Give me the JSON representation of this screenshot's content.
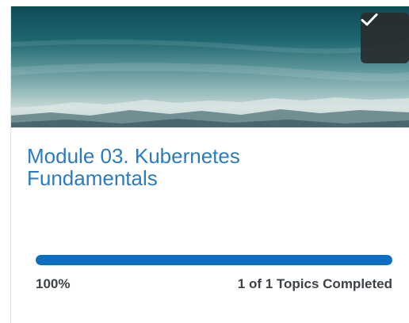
{
  "module": {
    "title": "Module 03. Kubernetes Fundamentals",
    "completed": true,
    "progress": {
      "percent_label": "100%",
      "fraction": 1.0,
      "topics_label": "1 of 1 Topics Completed"
    }
  },
  "icons": {
    "badge_icon": "checkmark-icon"
  },
  "colors": {
    "title_link": "#2b7bbf",
    "progress_fill": "#0a6fc2",
    "progress_track": "#e3e9f1",
    "badge_background": "#282c2e"
  }
}
